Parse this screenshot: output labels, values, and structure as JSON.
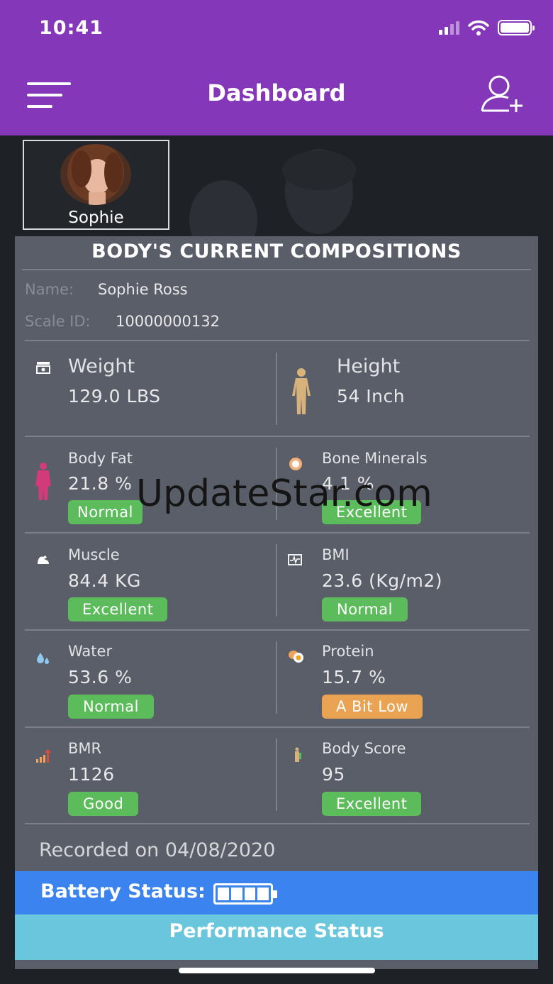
{
  "status_bar": {
    "time": "10:41"
  },
  "header": {
    "title": "Dashboard"
  },
  "profile": {
    "name": "Sophie"
  },
  "card": {
    "title": "BODY'S CURRENT COMPOSITIONS",
    "name_label": "Name:",
    "name_value": "Sophie Ross",
    "scale_label": "Scale ID:",
    "scale_value": "10000000132"
  },
  "metrics": {
    "weight": {
      "label": "Weight",
      "value": "129.0 LBS"
    },
    "height": {
      "label": "Height",
      "value": "54 Inch"
    },
    "body_fat": {
      "label": "Body Fat",
      "value": "21.8 %",
      "status": "Normal"
    },
    "bone": {
      "label": "Bone Minerals",
      "value": "4.1 %",
      "status": "Excellent"
    },
    "muscle": {
      "label": "Muscle",
      "value": "84.4 KG",
      "status": "Excellent"
    },
    "bmi": {
      "label": "BMI",
      "value": "23.6 (Kg/m2)",
      "status": "Normal"
    },
    "water": {
      "label": "Water",
      "value": "53.6 %",
      "status": "Normal"
    },
    "protein": {
      "label": "Protein",
      "value": "15.7 %",
      "status": "A Bit Low"
    },
    "bmr": {
      "label": "BMR",
      "value": "1126",
      "status": "Good"
    },
    "body_score": {
      "label": "Body Score",
      "value": "95",
      "status": "Excellent"
    }
  },
  "recorded": "Recorded on 04/08/2020",
  "battery": {
    "label": "Battery Status:",
    "level": 1.0
  },
  "performance": {
    "label": "Performance Status"
  },
  "watermark": "UpdateStar.com",
  "colors": {
    "header": "#8437b8",
    "card": "#5a5e68",
    "good": "#5cbb5a",
    "warn": "#e9a352",
    "battery_bar": "#3b84f0",
    "performance_bar": "#6ac6dc"
  }
}
